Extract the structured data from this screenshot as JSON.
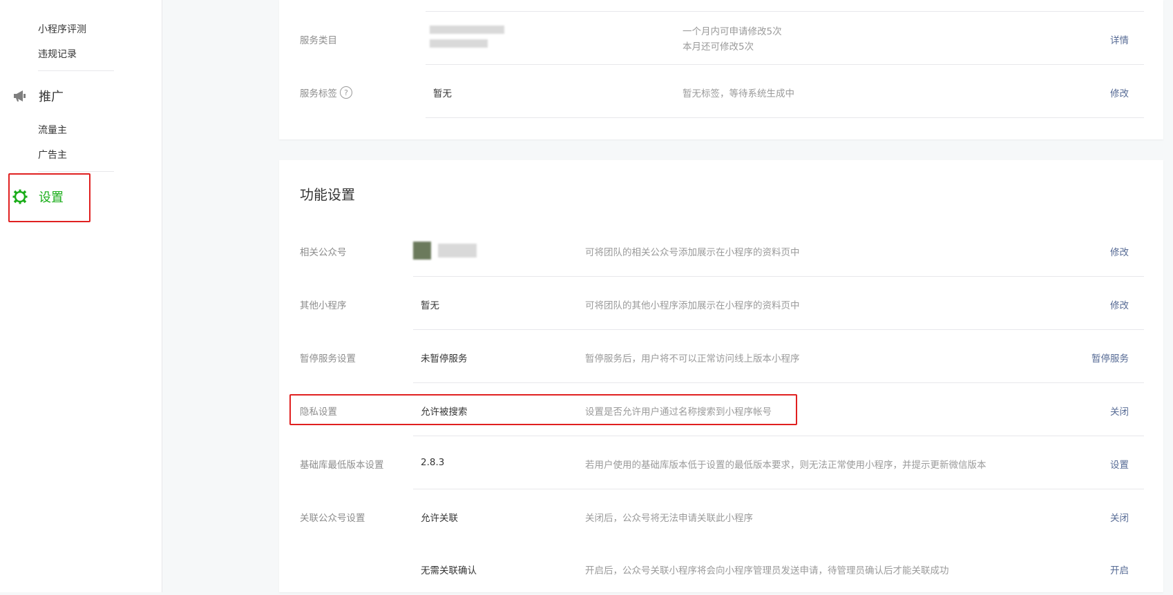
{
  "sidebar": {
    "sub_items_top": [
      "小程序评测",
      "违规记录"
    ],
    "promo_heading": "推广",
    "promo_items": [
      "流量主",
      "广告主"
    ],
    "settings_heading": "设置",
    "active_color": "#1aad19",
    "promo_icon": "megaphone-icon",
    "settings_icon": "gear-icon"
  },
  "service_card": {
    "rows": [
      {
        "label": "服务类目",
        "desc_lines": [
          "一个月内可申请修改5次",
          "本月还可修改5次"
        ],
        "action": "详情"
      },
      {
        "label": "服务标签",
        "help_icon": "?",
        "value": "暂无",
        "desc": "暂无标签，等待系统生成中",
        "action": "修改"
      }
    ]
  },
  "feature_card": {
    "title": "功能设置",
    "rows": [
      {
        "label": "相关公众号",
        "value": "",
        "desc": "可将团队的相关公众号添加展示在小程序的资料页中",
        "action": "修改"
      },
      {
        "label": "其他小程序",
        "value": "暂无",
        "desc": "可将团队的其他小程序添加展示在小程序的资料页中",
        "action": "修改"
      },
      {
        "label": "暂停服务设置",
        "value": "未暂停服务",
        "desc": "暂停服务后，用户将不可以正常访问线上版本小程序",
        "action": "暂停服务"
      },
      {
        "label": "隐私设置",
        "value": "允许被搜索",
        "desc": "设置是否允许用户通过名称搜索到小程序帐号",
        "action": "关闭"
      },
      {
        "label": "基础库最低版本设置",
        "value": "2.8.3",
        "desc": "若用户使用的基础库版本低于设置的最低版本要求，则无法正常使用小程序，并提示更新微信版本",
        "action": "设置"
      },
      {
        "label": "关联公众号设置",
        "value": "允许关联",
        "desc": "关闭后，公众号将无法申请关联此小程序",
        "action": "关闭"
      },
      {
        "label": "",
        "value": "无需关联确认",
        "desc": "开启后，公众号关联小程序将会向小程序管理员发送申请，待管理员确认后才能关联成功",
        "action": "开启"
      }
    ]
  },
  "colors": {
    "link": "#576b95",
    "highlight": "#e02020"
  }
}
